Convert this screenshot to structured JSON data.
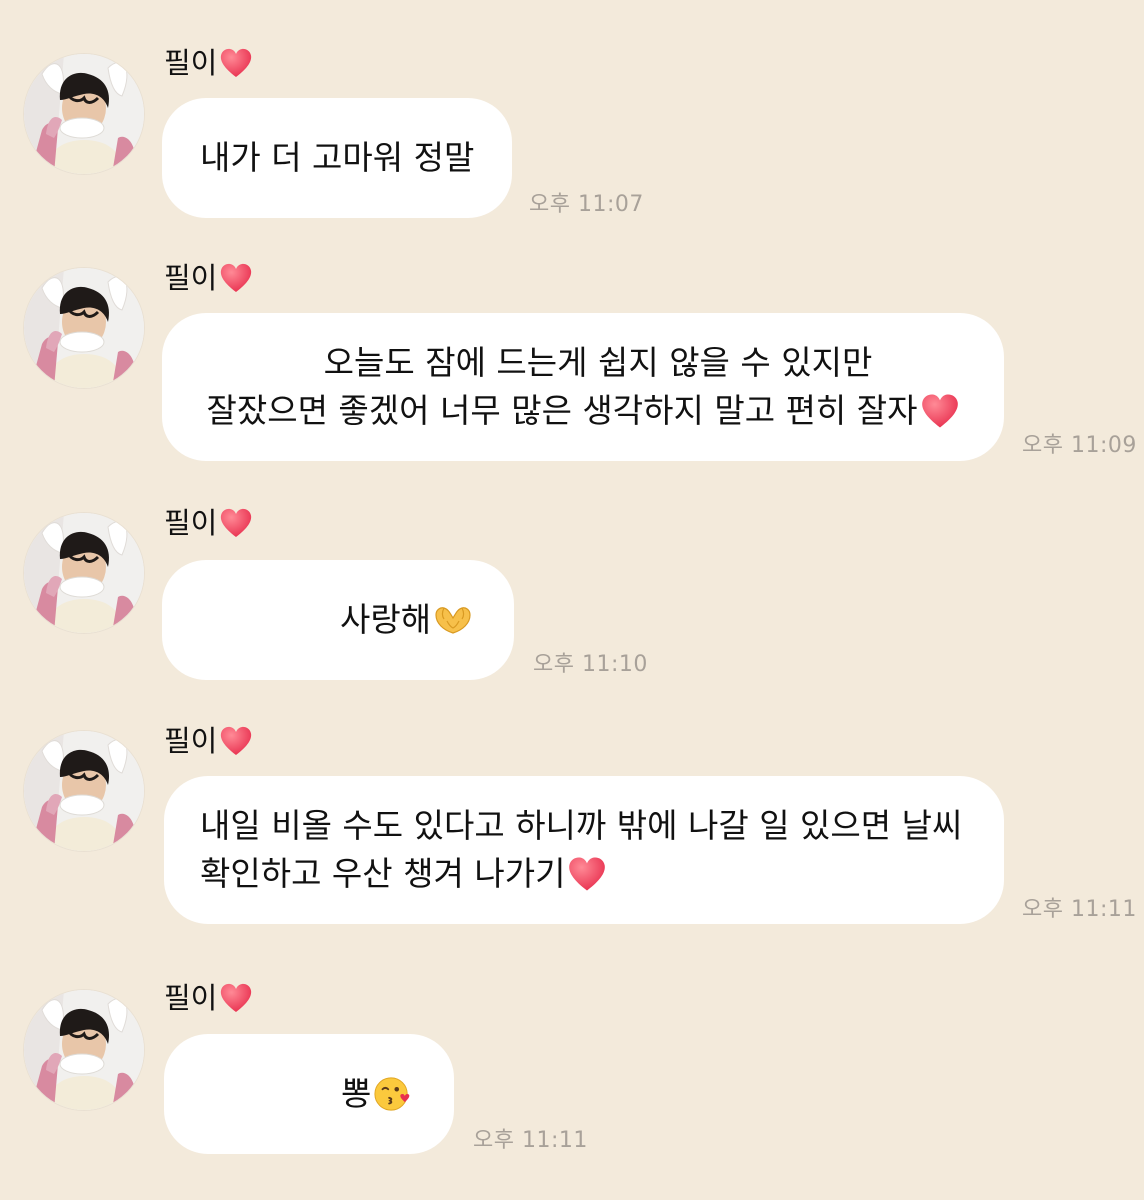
{
  "theme": {
    "background": "#f3eadb",
    "bubble": "#ffffff",
    "timestamp_color": "#a8a199",
    "heart_color": "#f0455e"
  },
  "messages": [
    {
      "sender": "필이",
      "sender_icon": "red-heart-icon",
      "lines": [
        "내가 더 고마워 정말"
      ],
      "end_icon": "",
      "time": "오후 11:07"
    },
    {
      "sender": "필이",
      "sender_icon": "red-heart-icon",
      "lines": [
        "오늘도 잠에 드는게 쉽지 않을 수 있지만",
        "잘잤으면 좋겠어 너무 많은 생각하지 말고 편히 잘자"
      ],
      "end_icon": "red-heart-icon",
      "time": "오후 11:09"
    },
    {
      "sender": "필이",
      "sender_icon": "red-heart-icon",
      "lines": [
        "사랑해"
      ],
      "end_icon": "heart-hands-icon",
      "time": "오후 11:10"
    },
    {
      "sender": "필이",
      "sender_icon": "red-heart-icon",
      "lines": [
        "내일 비올 수도 있다고 하니까 밖에 나갈 일 있으면 날씨",
        "확인하고 우산 챙겨 나가기"
      ],
      "end_icon": "red-heart-icon",
      "time": "오후 11:11"
    },
    {
      "sender": "필이",
      "sender_icon": "red-heart-icon",
      "lines": [
        "뽕"
      ],
      "end_icon": "kissing-face-icon",
      "time": "오후 11:11"
    }
  ]
}
